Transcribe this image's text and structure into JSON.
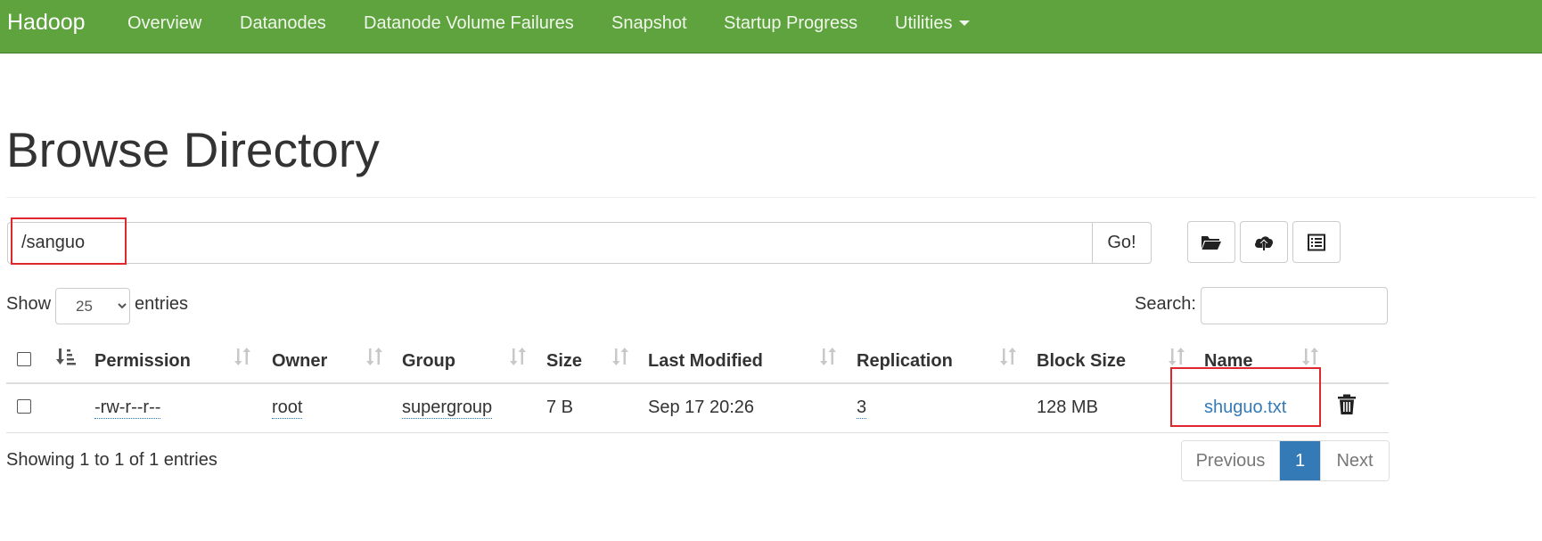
{
  "navbar": {
    "brand": "Hadoop",
    "items": [
      {
        "label": "Overview"
      },
      {
        "label": "Datanodes"
      },
      {
        "label": "Datanode Volume Failures"
      },
      {
        "label": "Snapshot"
      },
      {
        "label": "Startup Progress"
      },
      {
        "label": "Utilities",
        "has_dropdown": true
      }
    ],
    "bg_color": "#5fa33e"
  },
  "page_title": "Browse Directory",
  "path_bar": {
    "value": "/sanguo",
    "go_label": "Go!",
    "icons": [
      "folder-open-icon",
      "upload-cloud-icon",
      "list-icon"
    ]
  },
  "table_controls": {
    "show_label": "Show",
    "page_length": "25",
    "page_length_options": [
      "25"
    ],
    "entries_label": "entries",
    "search_label": "Search:",
    "search_value": ""
  },
  "table": {
    "columns": [
      "Permission",
      "Owner",
      "Group",
      "Size",
      "Last Modified",
      "Replication",
      "Block Size",
      "Name"
    ],
    "rows": [
      {
        "permission": "-rw-r--r--",
        "owner": "root",
        "group": "supergroup",
        "size": "7 B",
        "last_modified": "Sep 17 20:26",
        "replication": "3",
        "block_size": "128 MB",
        "name": "shuguo.txt"
      }
    ]
  },
  "footer": {
    "info": "Showing 1 to 1 of 1 entries",
    "pagination": {
      "previous": "Previous",
      "current": "1",
      "next": "Next"
    }
  },
  "colors": {
    "link": "#337ab7",
    "highlight_box": "#e0272d",
    "active_page": "#337ab7"
  }
}
